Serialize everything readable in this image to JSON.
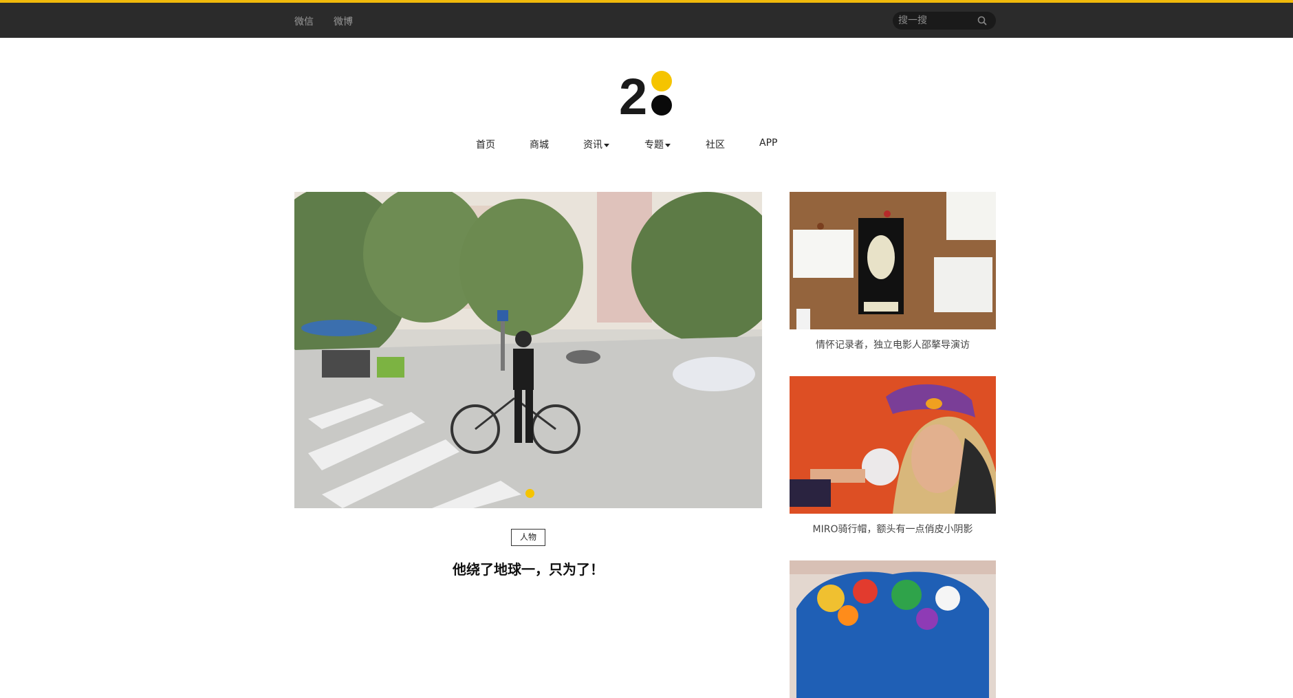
{
  "topbar": {
    "links": [
      {
        "label": "微信"
      },
      {
        "label": "微博"
      }
    ],
    "search": {
      "placeholder": "搜一搜"
    }
  },
  "logo": {
    "text": "2"
  },
  "nav": {
    "items": [
      {
        "label": "首页"
      },
      {
        "label": "商城"
      },
      {
        "label": "资讯"
      },
      {
        "label": "专题"
      },
      {
        "label": "社区"
      },
      {
        "label": "APP"
      }
    ]
  },
  "feature": {
    "tag": "人物",
    "title": "他绕了地球一，只为了！"
  },
  "side_cards": [
    {
      "title": "情怀记录者，独立电影人邵摮导演访"
    },
    {
      "title": "MIRO骑行帽，额头有一点俏皮小阴影"
    },
    {
      "title": ""
    }
  ],
  "colors": {
    "accent": "#f5c400",
    "topbar_bg": "#2b2b2b"
  }
}
